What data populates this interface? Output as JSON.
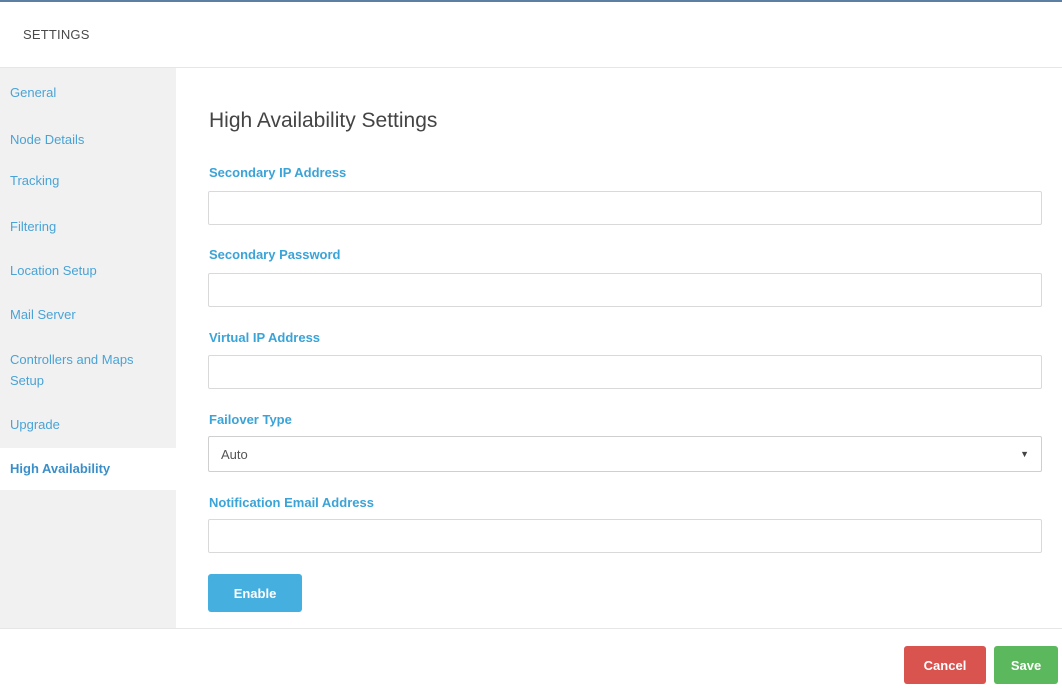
{
  "header": {
    "title": "SETTINGS"
  },
  "sidebar": {
    "items": [
      {
        "label": "General"
      },
      {
        "label": "Node Details"
      },
      {
        "label": "Tracking"
      },
      {
        "label": "Filtering"
      },
      {
        "label": "Location Setup"
      },
      {
        "label": "Mail Server"
      },
      {
        "label": "Controllers and Maps Setup"
      },
      {
        "label": "Upgrade"
      },
      {
        "label": "High Availability",
        "active": true
      }
    ]
  },
  "main": {
    "title": "High Availability Settings",
    "fields": {
      "secondary_ip": {
        "label": "Secondary IP Address",
        "value": "",
        "placeholder": ""
      },
      "secondary_password": {
        "label": "Secondary Password",
        "value": "",
        "placeholder": ""
      },
      "virtual_ip": {
        "label": "Virtual IP Address",
        "value": "",
        "placeholder": ""
      },
      "failover_type": {
        "label": "Failover Type",
        "selected": "Auto"
      },
      "notification_email": {
        "label": "Notification Email Address",
        "value": "",
        "placeholder": ""
      }
    },
    "enable_label": "Enable"
  },
  "footer": {
    "cancel_label": "Cancel",
    "save_label": "Save"
  },
  "colors": {
    "accent": "#3aa3d7",
    "enable": "#45afe0",
    "cancel": "#d9534f",
    "save": "#5cb85c",
    "sidebar_bg": "#f1f1f1"
  }
}
